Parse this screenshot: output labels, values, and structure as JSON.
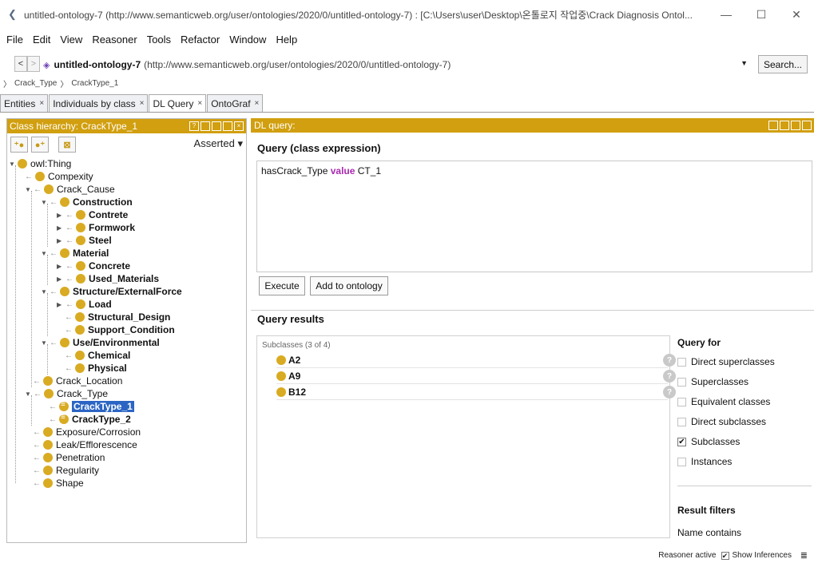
{
  "window": {
    "title": "untitled-ontology-7 (http://www.semanticweb.org/user/ontologies/2020/0/untitled-ontology-7)  : [C:\\Users\\user\\Desktop\\온톨로지 작업중\\Crack Diagnosis Ontol...",
    "minimize": "—",
    "maximize": "☐",
    "close": "✕"
  },
  "menu": [
    "File",
    "Edit",
    "View",
    "Reasoner",
    "Tools",
    "Refactor",
    "Window",
    "Help"
  ],
  "address": {
    "back": "<",
    "forward": ">",
    "ontology_name": "untitled-ontology-7",
    "ontology_iri": "(http://www.semanticweb.org/user/ontologies/2020/0/untitled-ontology-7)",
    "search_label": "Search..."
  },
  "breadcrumb": [
    "Crack_Type",
    "CrackType_1"
  ],
  "tabs": [
    "Entities",
    "Individuals by class",
    "DL Query",
    "OntoGraf"
  ],
  "tab_close": "×",
  "left_panel": {
    "title": "Class hierarchy: CrackType_1",
    "mode": "Asserted ▾",
    "tree": [
      {
        "label": "owl:Thing"
      },
      {
        "label": "Compexity"
      },
      {
        "label": "Crack_Cause"
      },
      {
        "label": "Construction"
      },
      {
        "label": "Contrete"
      },
      {
        "label": "Formwork"
      },
      {
        "label": "Steel"
      },
      {
        "label": "Material"
      },
      {
        "label": "Concrete"
      },
      {
        "label": "Used_Materials"
      },
      {
        "label": "Structure/ExternalForce"
      },
      {
        "label": "Load"
      },
      {
        "label": "Structural_Design"
      },
      {
        "label": "Support_Condition"
      },
      {
        "label": "Use/Environmental"
      },
      {
        "label": "Chemical"
      },
      {
        "label": "Physical"
      },
      {
        "label": "Crack_Location"
      },
      {
        "label": "Crack_Type"
      },
      {
        "label": "CrackType_1"
      },
      {
        "label": "CrackType_2"
      },
      {
        "label": "Exposure/Corrosion"
      },
      {
        "label": "Leak/Efflorescence"
      },
      {
        "label": "Penetration"
      },
      {
        "label": "Regularity"
      },
      {
        "label": "Shape"
      }
    ]
  },
  "right_panel": {
    "title": "DL query:",
    "query_heading": "Query (class expression)",
    "query_prop": "hasCrack_Type",
    "query_kw": "value",
    "query_val": "CT_1",
    "execute_label": "Execute",
    "add_label": "Add to ontology",
    "results_heading": "Query results",
    "results_sub": "Subclasses (3 of 4)",
    "results": [
      "A2",
      "A9",
      "B12"
    ],
    "help_glyph": "?",
    "query_for": {
      "title": "Query for",
      "options": [
        {
          "label": "Direct superclasses",
          "checked": false
        },
        {
          "label": "Superclasses",
          "checked": false
        },
        {
          "label": "Equivalent classes",
          "checked": false
        },
        {
          "label": "Direct subclasses",
          "checked": false
        },
        {
          "label": "Subclasses",
          "checked": true
        },
        {
          "label": "Instances",
          "checked": false
        }
      ],
      "filters_title": "Result filters",
      "name_contains": "Name contains"
    }
  },
  "status": {
    "reasoner": "Reasoner active",
    "show_inferences": "Show Inferences"
  },
  "colors": {
    "header": "#d19f0f",
    "class_ball": "#d9ab22",
    "selection": "#2b65c4",
    "keyword": "#a82ab0"
  }
}
